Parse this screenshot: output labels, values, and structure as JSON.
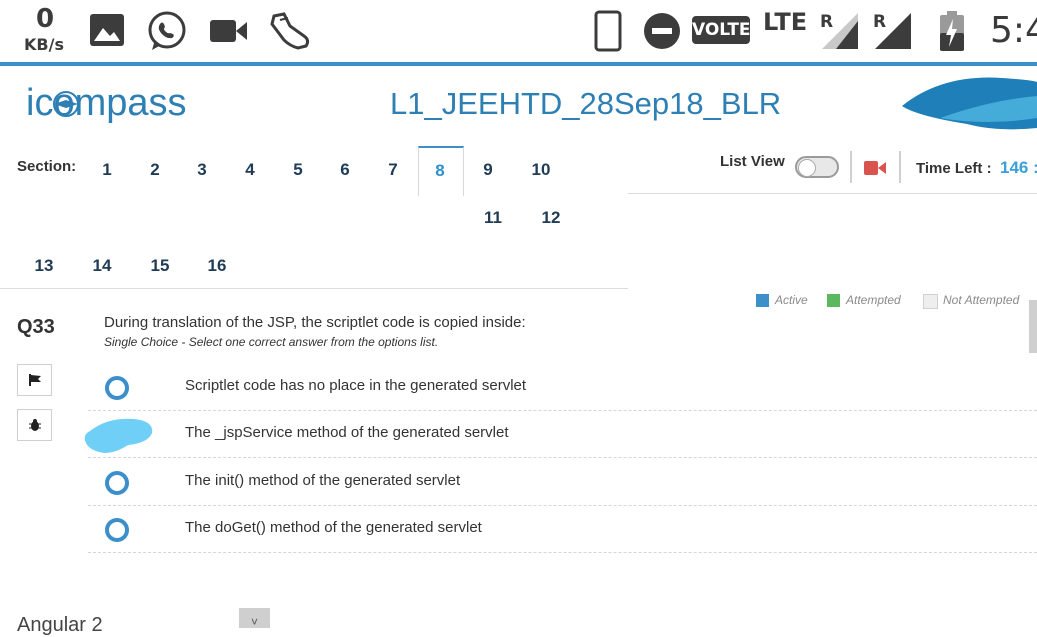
{
  "status_bar": {
    "speed_value": "0",
    "speed_unit": "KB/s",
    "volte": "VOLTE",
    "lte": "LTE",
    "roaming1": "R",
    "roaming2": "R",
    "time": "5:4",
    "icons": [
      "image-icon",
      "whatsapp-icon",
      "video-camera-icon",
      "sneaker-icon",
      "phone-icon",
      "do-not-disturb-icon",
      "signal-icon",
      "signal-icon",
      "battery-icon"
    ]
  },
  "header": {
    "logo_text": "icompass",
    "exam_title": "L1_JEEHTD_28Sep18_BLR"
  },
  "sections": {
    "label": "Section:",
    "numbers": [
      "1",
      "2",
      "3",
      "4",
      "5",
      "6",
      "7",
      "8",
      "9",
      "10",
      "11",
      "12",
      "13",
      "14",
      "15",
      "16"
    ],
    "active": "8"
  },
  "controls": {
    "list_view_label": "List View",
    "time_left_label": "Time Left :",
    "time_left_value": "146 :"
  },
  "legend": {
    "active": "Active",
    "attempted": "Attempted",
    "not_attempted": "Not Attempted",
    "colors": {
      "active": "#3d8fc9",
      "attempted": "#5cb85c",
      "not_attempted": "#eeeeee"
    }
  },
  "question": {
    "number": "Q33",
    "text": "During translation of the JSP, the scriptlet code is copied inside:",
    "hint": "Single Choice - Select one correct answer from the options list.",
    "options": [
      "Scriptlet code has no place in the generated servlet",
      "The _jspService method of the generated servlet",
      "The init() method of the generated servlet",
      "The doGet() method of the generated servlet"
    ]
  },
  "next_section": {
    "title": "Angular 2",
    "chevron": "˅"
  }
}
